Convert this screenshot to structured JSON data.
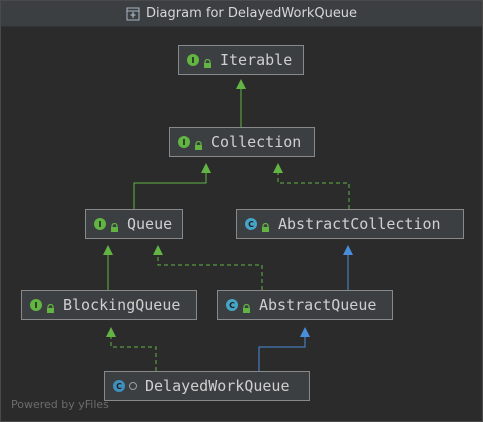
{
  "window": {
    "title": "Diagram for DelayedWorkQueue",
    "title_icon": "diagram-icon"
  },
  "nodes": {
    "iterable": {
      "label": "Iterable",
      "kind": "interface",
      "kind_letter": "I"
    },
    "collection": {
      "label": "Collection",
      "kind": "interface",
      "kind_letter": "I"
    },
    "queue": {
      "label": "Queue",
      "kind": "interface",
      "kind_letter": "I"
    },
    "abstract_collection": {
      "label": "AbstractCollection",
      "kind": "abstract-class",
      "kind_letter": "C"
    },
    "blocking_queue": {
      "label": "BlockingQueue",
      "kind": "interface",
      "kind_letter": "I"
    },
    "abstract_queue": {
      "label": "AbstractQueue",
      "kind": "abstract-class",
      "kind_letter": "C"
    },
    "delayed_work_queue": {
      "label": "DelayedWorkQueue",
      "kind": "class",
      "kind_letter": "C"
    }
  },
  "footer": {
    "text": "Powered by yFiles"
  },
  "colors": {
    "extends_interface": "#62b543",
    "extends_class": "#4a8edb",
    "node_border": "#898989",
    "node_bg": "#3c3f41",
    "canvas_bg": "#2b2b2b"
  }
}
